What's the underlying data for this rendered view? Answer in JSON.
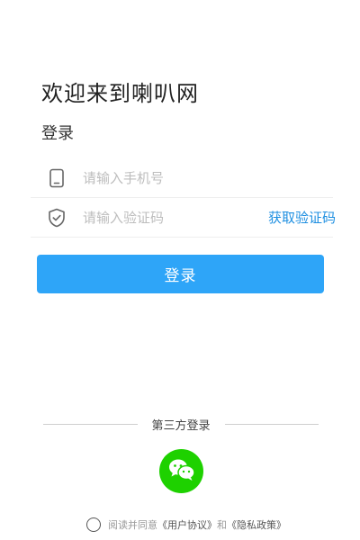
{
  "header": {
    "welcome": "欢迎来到喇叭网",
    "subtitle": "登录"
  },
  "form": {
    "phone_placeholder": "请输入手机号",
    "code_placeholder": "请输入验证码",
    "get_code_label": "获取验证码",
    "login_label": "登录"
  },
  "third_party": {
    "label": "第三方登录"
  },
  "agreement": {
    "prefix": "阅读并同意",
    "user_agreement": "《用户协议》",
    "and": "和",
    "privacy_policy": "《隐私政策》"
  },
  "colors": {
    "accent": "#2ea5f8",
    "link": "#1e8fe1",
    "wechat": "#1ed100"
  },
  "icons": {
    "phone": "phone-icon",
    "shield": "shield-check-icon",
    "wechat": "wechat-icon"
  }
}
